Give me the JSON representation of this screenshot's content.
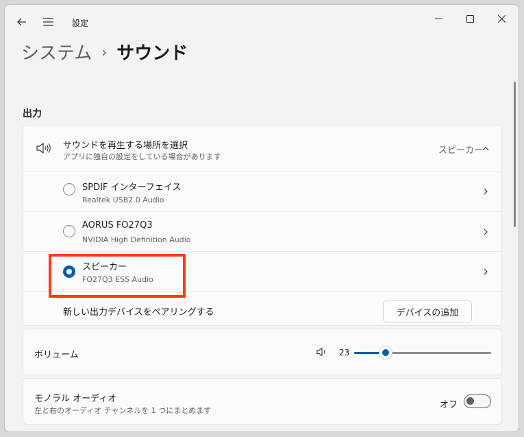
{
  "app": {
    "title": "設定"
  },
  "breadcrumb": {
    "parent": "システム",
    "separator": "›",
    "current": "サウンド"
  },
  "output_section": {
    "title": "出力",
    "selector": {
      "title": "サウンドを再生する場所を選択",
      "subtitle": "アプリに独自の設定をしている場合があります",
      "current_value": "スピーカー"
    },
    "devices": [
      {
        "name": "SPDIF インターフェイス",
        "detail": "Realtek USB2.0 Audio",
        "selected": false
      },
      {
        "name": "AORUS FO27Q3",
        "detail": "NVIDIA High Definition Audio",
        "selected": false
      },
      {
        "name": "スピーカー",
        "detail": "FO27Q3 ESS Audio",
        "selected": true
      }
    ],
    "pair": {
      "label": "新しい出力デバイスをペアリングする",
      "button_label": "デバイスの追加"
    }
  },
  "volume": {
    "label": "ボリューム",
    "value_text": "23",
    "value": 23,
    "max": 100
  },
  "mono": {
    "title": "モノラル オーディオ",
    "subtitle": "左と右のオーディオ チャンネルを 1 つにまとめます",
    "state_label": "オフ",
    "on": false
  },
  "colors": {
    "accent": "#0f5bab",
    "highlight": "#ff3b12"
  }
}
